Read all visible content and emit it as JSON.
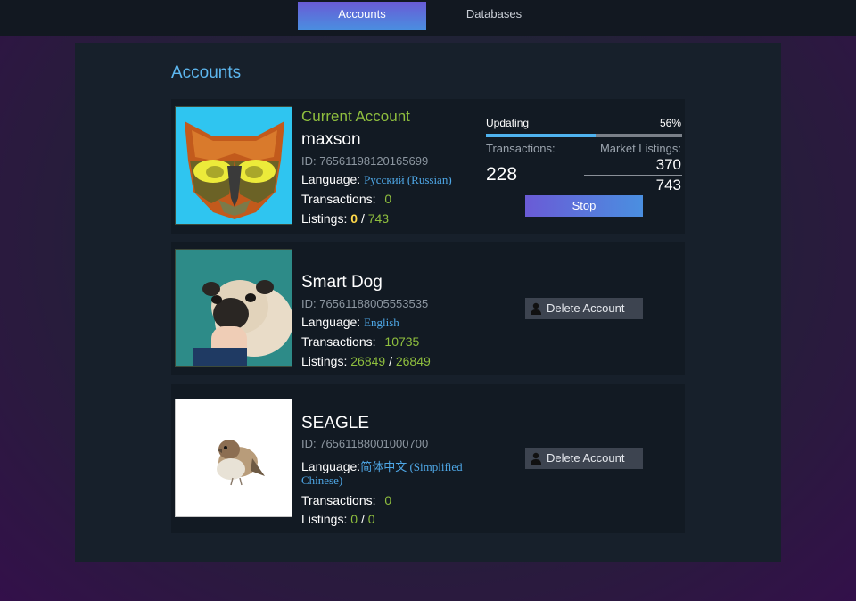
{
  "nav": {
    "tabs": [
      {
        "label": "Accounts"
      },
      {
        "label": "Databases"
      }
    ]
  },
  "page": {
    "title": "Accounts"
  },
  "accounts": [
    {
      "badge": "Current Account",
      "name": "maxson",
      "id": "ID: 76561198120165699",
      "language_label": "Language:",
      "language": "Русский (Russian)",
      "transactions_label": "Transactions:",
      "transactions": "0",
      "listings_label": "Listings:",
      "listings_current": "0",
      "listings_sep": "/",
      "listings_total": "743",
      "avatar_icon": "owl-avatar",
      "update": {
        "label": "Updating",
        "percent_text": "56%",
        "progress": 0.56,
        "transactions_label": "Transactions:",
        "transactions_value": "228",
        "market_label": "Market Listings:",
        "market_current": "370",
        "market_total": "743",
        "stop_label": "Stop"
      }
    },
    {
      "name": "Smart Dog",
      "id": "ID: 76561188005553535",
      "language_label": "Language:",
      "language": "English",
      "transactions_label": "Transactions:",
      "transactions": "10735",
      "listings_label": "Listings:",
      "listings_current": "26849",
      "listings_sep": "/",
      "listings_total": "26849",
      "avatar_icon": "pug-avatar",
      "delete_label": "Delete Account"
    },
    {
      "name": "SEAGLE",
      "id": "ID: 76561188001000700",
      "language_label": "Language:",
      "language_a": "简体中文 (Simplified",
      "language_b": "Chinese)",
      "transactions_label": "Transactions:",
      "transactions": "0",
      "listings_label": "Listings:",
      "listings_current": "0",
      "listings_sep": "/",
      "listings_total": "0",
      "avatar_icon": "sparrow-avatar",
      "delete_label": "Delete Account"
    }
  ],
  "colors": {
    "accent_blue": "#5db6ee",
    "green": "#8fbf3e",
    "yellow": "#ffd84a",
    "button_gradient_start": "#6a5bd6",
    "button_gradient_end": "#4a8fe0"
  }
}
